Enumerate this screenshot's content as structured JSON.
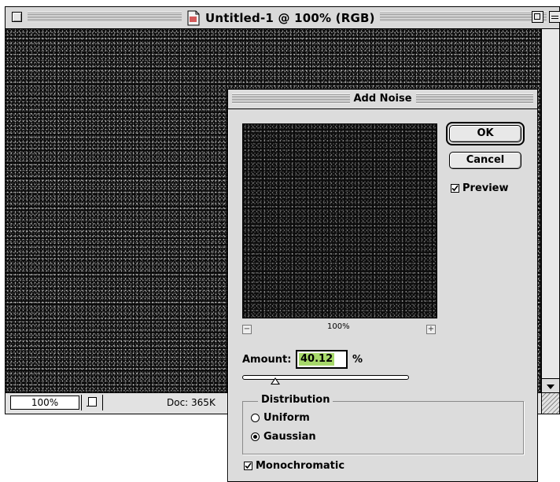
{
  "document_window": {
    "title": "Untitled-1 @ 100% (RGB)",
    "status": {
      "zoom": "100%",
      "doc_size": "Doc: 365K"
    }
  },
  "dialog": {
    "title": "Add Noise",
    "buttons": {
      "ok": "OK",
      "cancel": "Cancel"
    },
    "preview_checkbox": {
      "label": "Preview",
      "checked": true
    },
    "preview_zoom": "100%",
    "zoom_out": "−",
    "zoom_in": "+",
    "amount": {
      "label": "Amount:",
      "value": "40.12",
      "unit": "%",
      "slider_fraction": 0.2
    },
    "distribution": {
      "title": "Distribution",
      "options": [
        {
          "label": "Uniform",
          "selected": false
        },
        {
          "label": "Gaussian",
          "selected": true
        }
      ]
    },
    "monochromatic_checkbox": {
      "label": "Monochromatic",
      "checked": true
    }
  },
  "colors": {
    "amount_highlight": "#a7d96a",
    "window_bg": "#dcdcdc"
  }
}
